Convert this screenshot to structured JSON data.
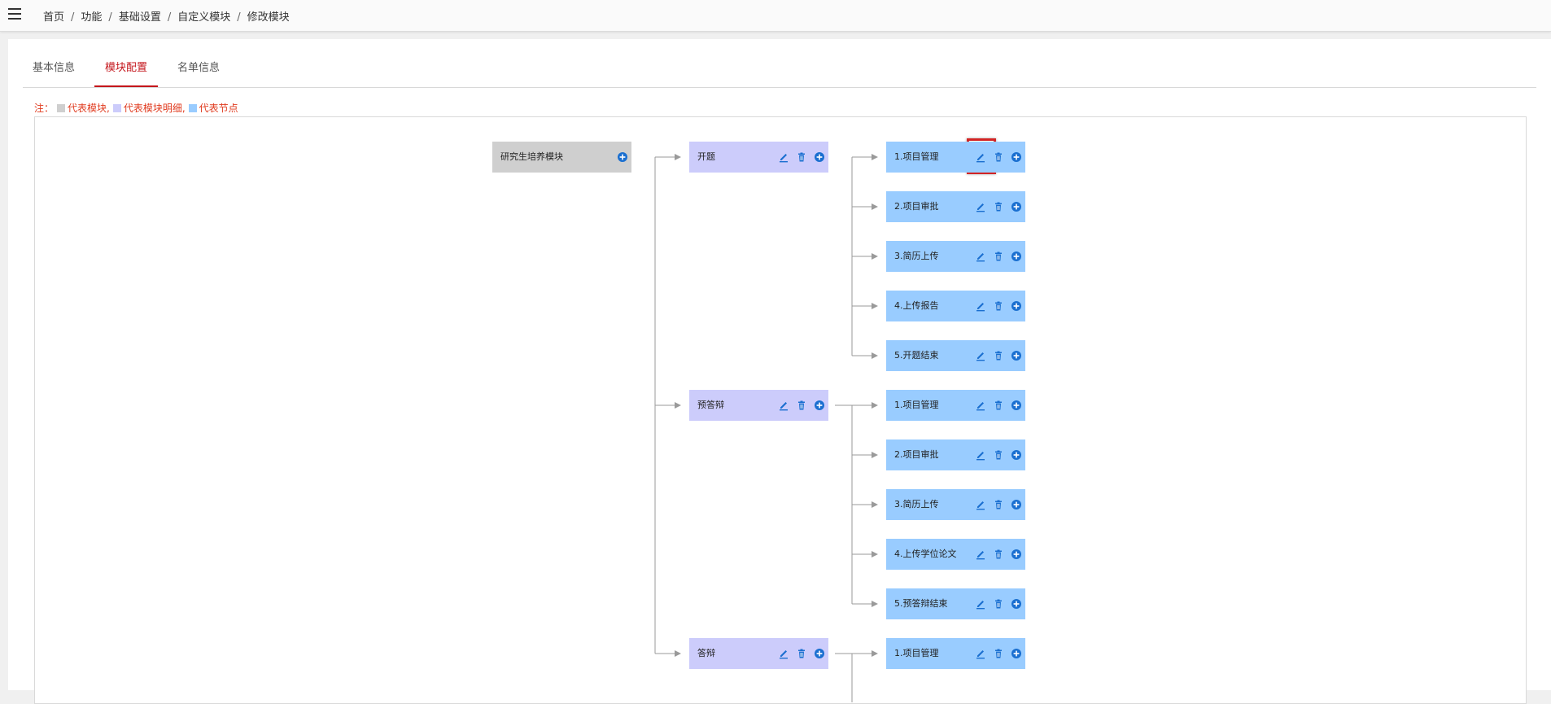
{
  "breadcrumb": [
    "首页",
    "功能",
    "基础设置",
    "自定义模块",
    "修改模块"
  ],
  "tabs": [
    "基本信息",
    "模块配置",
    "名单信息"
  ],
  "active_tab": "模块配置",
  "legend": {
    "prefix": "注：",
    "module": "代表模块,",
    "detail": "代表模块明细,",
    "node": "代表节点"
  },
  "colors": {
    "module": "#cfcfcf",
    "detail": "#ccccfb",
    "node": "#99ccff",
    "accent": "#c4161c",
    "icon": "#1a6fd0",
    "note": "#e03a1e"
  },
  "root": {
    "label": "研究生培养模块",
    "icons": [
      "add-icon"
    ]
  },
  "groups": [
    {
      "label": "开题",
      "icons": [
        "edit-icon",
        "delete-icon",
        "add-icon"
      ],
      "nodes": [
        "1.项目管理",
        "2.项目审批",
        "3.简历上传",
        "4.上传报告",
        "5.开题结束"
      ]
    },
    {
      "label": "预答辩",
      "icons": [
        "edit-icon",
        "delete-icon",
        "add-icon"
      ],
      "nodes": [
        "1.项目管理",
        "2.项目审批",
        "3.简历上传",
        "4.上传学位论文",
        "5.预答辩结束"
      ]
    },
    {
      "label": "答辩",
      "icons": [
        "edit-icon",
        "delete-icon",
        "add-icon"
      ],
      "nodes": [
        "1.项目管理"
      ]
    }
  ],
  "highlighted": {
    "group": 0,
    "node": 0,
    "icon": "edit-icon"
  }
}
